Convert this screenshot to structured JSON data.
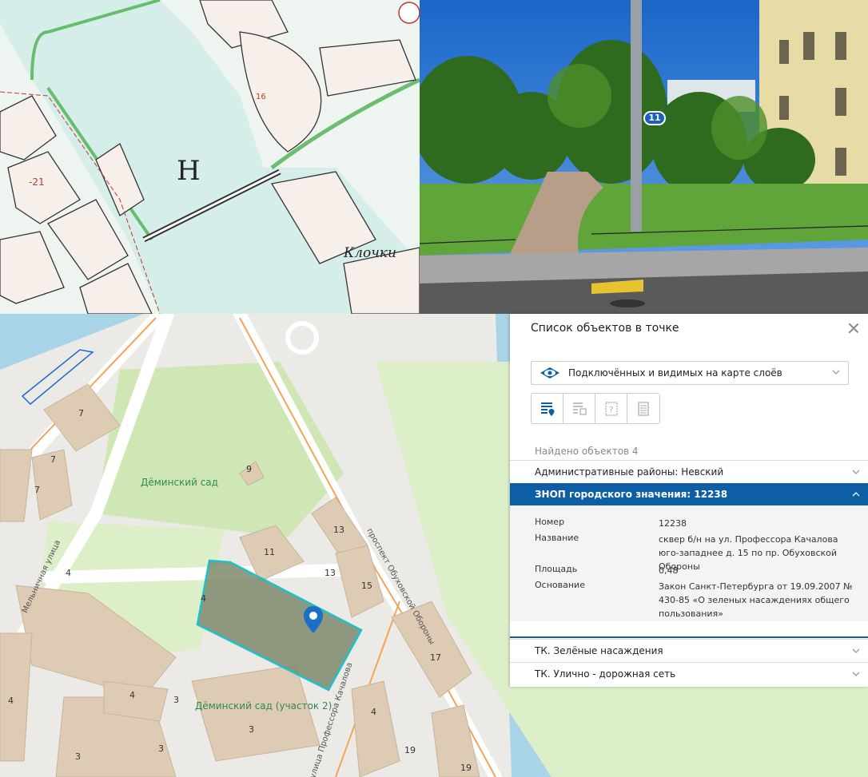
{
  "photo": {
    "marker_number": "11"
  },
  "old_map": {
    "labels": [
      "Клочки",
      "Н",
      "-21",
      "16"
    ]
  },
  "map": {
    "parks": [
      "Дёминский сад",
      "Дёминский сад (участок 2)"
    ],
    "streets": [
      "проспект Обуховской Обороны",
      "Мельничная улица",
      "улица Профессора Качалова"
    ],
    "building_numbers": [
      "7",
      "7",
      "7",
      "9",
      "13",
      "11",
      "13",
      "15",
      "4",
      "4",
      "17",
      "4",
      "3",
      "3",
      "3",
      "3",
      "4",
      "19",
      "19",
      "4"
    ]
  },
  "panel": {
    "title": "Список объектов в точке",
    "layer_select": "Подключённых и видимых на карте слоёв",
    "found_label": "Найдено объектов 4",
    "sections": [
      {
        "label": "Административные районы: Невский",
        "expanded": false
      },
      {
        "label": "ЗНОП городского значения: 12238",
        "expanded": true
      },
      {
        "label": "ТК. Зелёные насаждения",
        "expanded": false
      },
      {
        "label": "ТК. Улично - дорожная сеть",
        "expanded": false
      }
    ],
    "attributes": [
      {
        "key": "Номер",
        "value": "12238"
      },
      {
        "key": "Название",
        "value": "сквер б/н на ул. Профессора Качалова юго-западнее д. 15 по пр. Обуховской Обороны"
      },
      {
        "key": "Площадь",
        "value": "0,48"
      },
      {
        "key": "Основание",
        "value": "Закон Санкт-Петербурга от 19.09.2007 № 430-85 «О зеленых насаждениях общего пользования»"
      }
    ],
    "accent_color": "#0d5ea4"
  }
}
